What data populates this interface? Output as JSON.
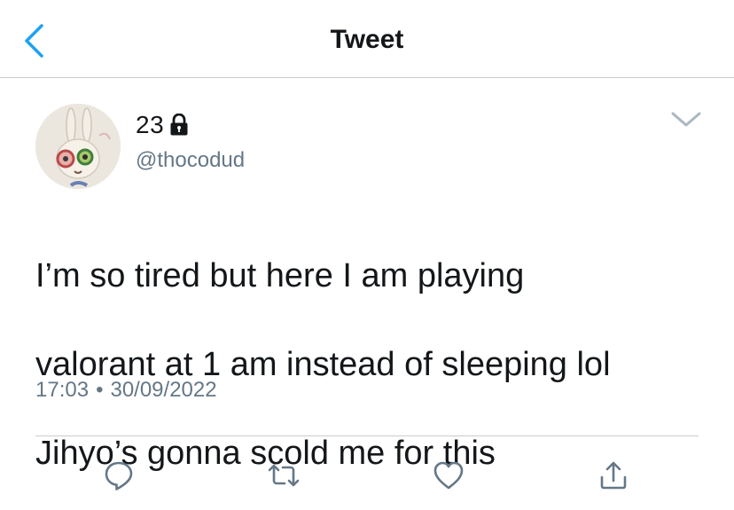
{
  "header": {
    "title": "Tweet",
    "back_icon": "chevron-left-icon"
  },
  "tweet": {
    "author": {
      "display_name": "23",
      "handle": "@thocodud",
      "protected_icon": "lock-icon"
    },
    "text_lines": [
      "I’m so tired but here I am playing",
      "valorant at 1 am instead of sleeping lol",
      "Jihyo’s gonna scold me for this"
    ],
    "time": "17:03",
    "separator": "•",
    "date": "30/09/2022"
  },
  "actions": [
    {
      "name": "reply",
      "icon": "reply-icon"
    },
    {
      "name": "retweet",
      "icon": "retweet-icon"
    },
    {
      "name": "like",
      "icon": "heart-icon"
    },
    {
      "name": "share",
      "icon": "share-icon"
    }
  ],
  "colors": {
    "accent": "#1da1f2",
    "text": "#14171a",
    "secondary_text": "#657786",
    "divider": "#c8ccd0",
    "icon_gray": "#657786"
  }
}
